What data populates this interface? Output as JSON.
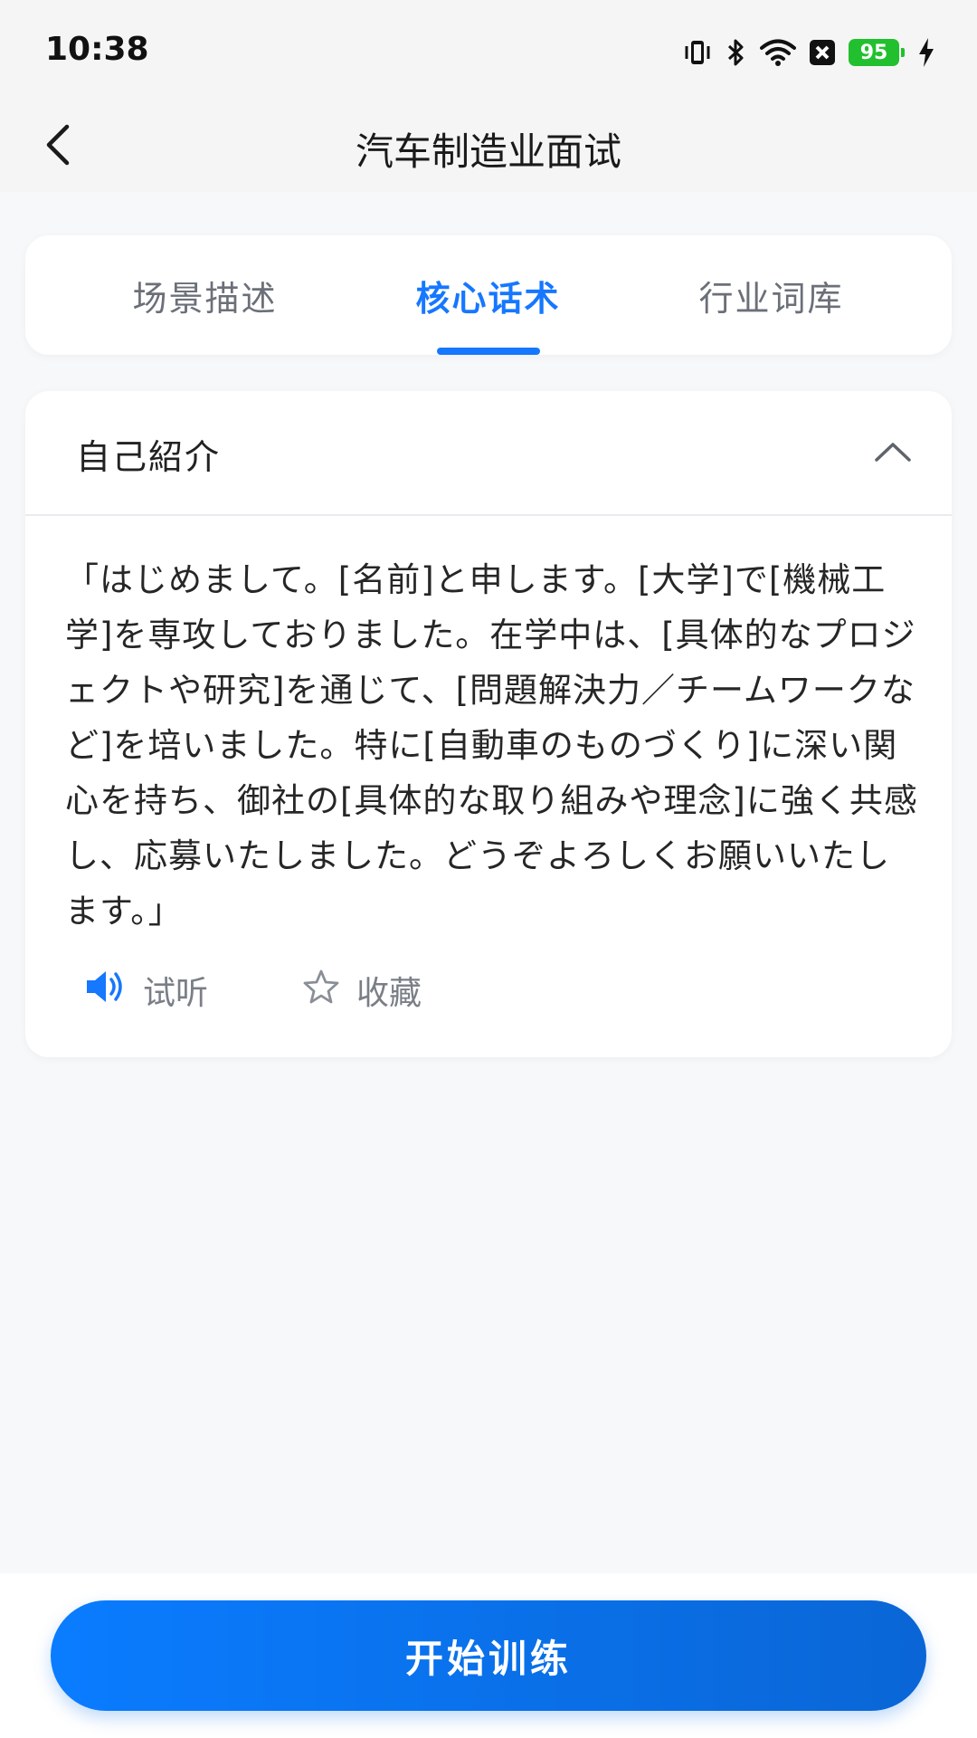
{
  "status_bar": {
    "time": "10:38",
    "battery_level": "95",
    "icons": [
      "vibrate-icon",
      "bluetooth-icon",
      "wifi-icon",
      "sim-off-icon",
      "battery-icon",
      "charging-icon"
    ]
  },
  "header": {
    "title": "汽车制造业面试",
    "back_icon": "chevron-left-icon"
  },
  "tabs": {
    "items": [
      {
        "label": "场景描述",
        "active": false
      },
      {
        "label": "核心话术",
        "active": true
      },
      {
        "label": "行业词库",
        "active": false
      }
    ]
  },
  "section": {
    "title": "自己紹介",
    "toggle_icon": "chevron-up-icon",
    "body": "「はじめまして。[名前]と申します。[大学]で[機械工学]を専攻しておりました。在学中は、[具体的なプロジェクトや研究]を通じて、[問題解決力／チームワークなど]を培いました。特に[自動車のものづくり]に深い関心を持ち、御社の[具体的な取り組みや理念]に強く共感し、応募いたしました。どうぞよろしくお願いいたします。」",
    "actions": {
      "listen_label": "试听",
      "favorite_label": "收藏"
    }
  },
  "bottom": {
    "start_label": "开始训练"
  },
  "colors": {
    "accent": "#1677ff",
    "background": "#f7f8fa",
    "battery": "#22c02e"
  }
}
